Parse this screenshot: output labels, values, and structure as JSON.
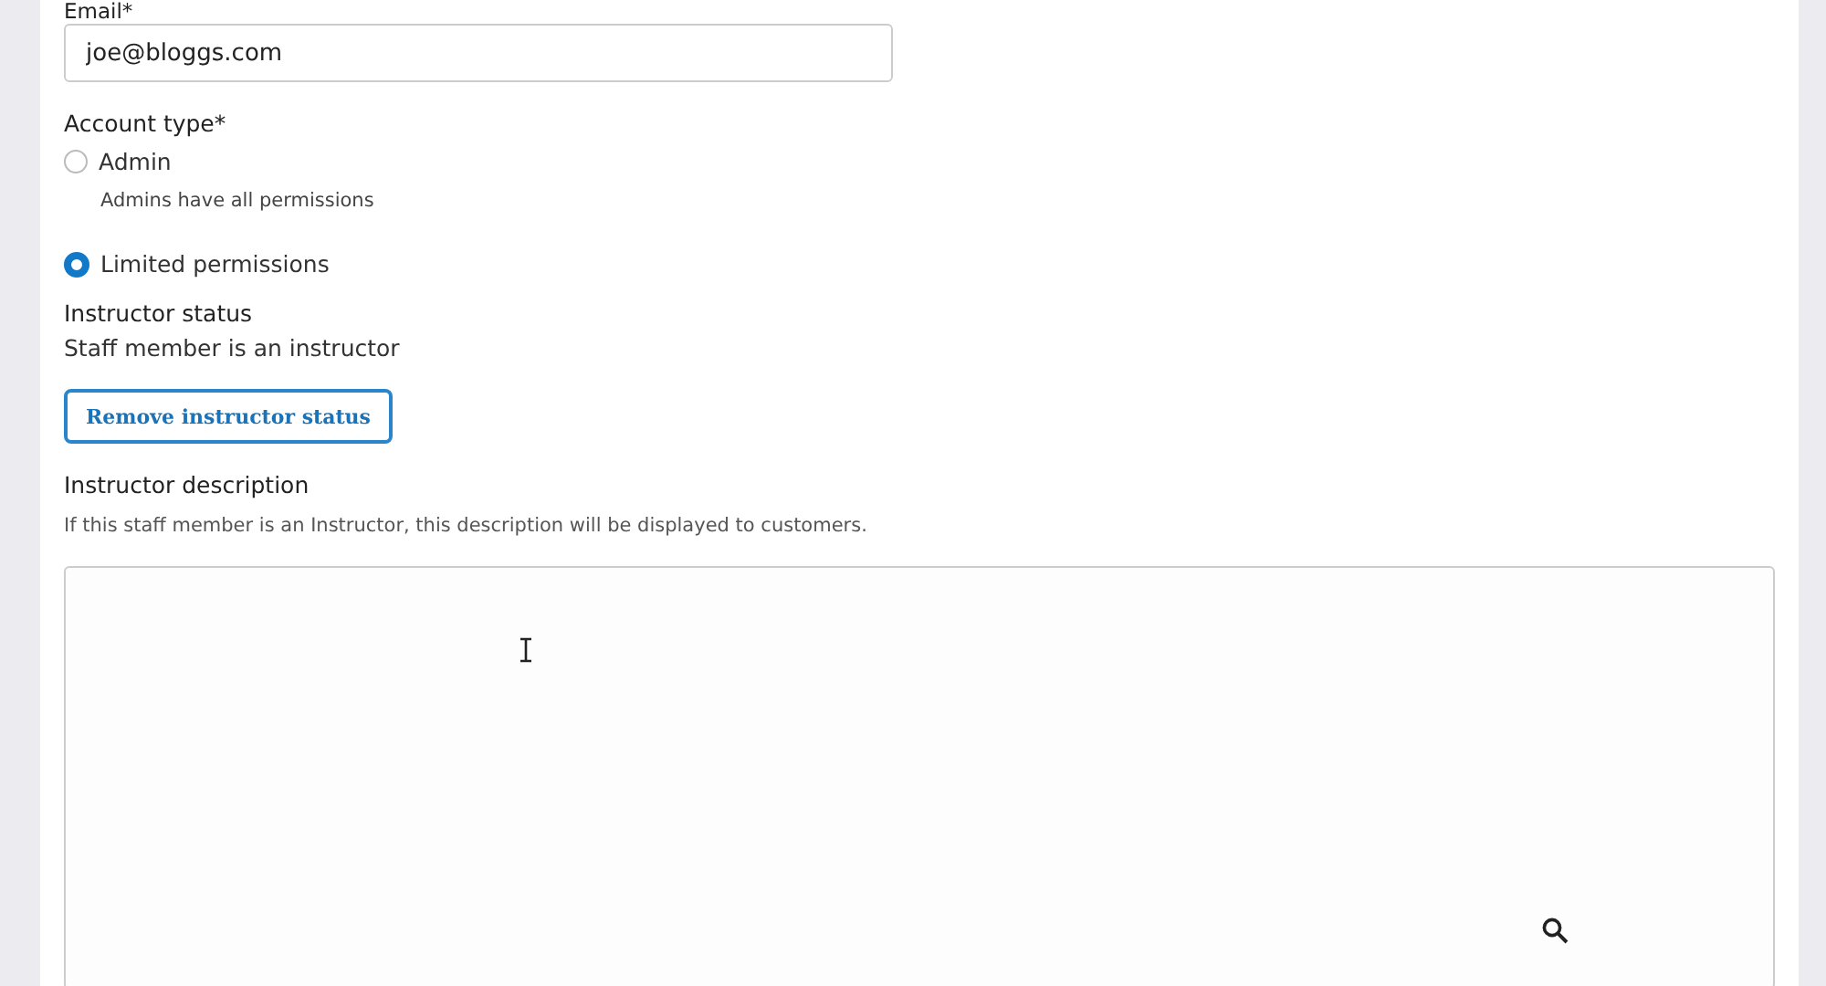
{
  "email": {
    "label": "Email*",
    "value": "joe@bloggs.com"
  },
  "account_type": {
    "label": "Account type*",
    "options": [
      {
        "label": "Admin",
        "hint": "Admins have all permissions",
        "selected": false
      },
      {
        "label": "Limited permissions",
        "selected": true
      }
    ]
  },
  "instructor_status": {
    "label": "Instructor status",
    "text": "Staff member is an instructor",
    "button": "Remove instructor status"
  },
  "instructor_description": {
    "label": "Instructor description",
    "help": "If this staff member is an Instructor, this description will be displayed to customers."
  }
}
